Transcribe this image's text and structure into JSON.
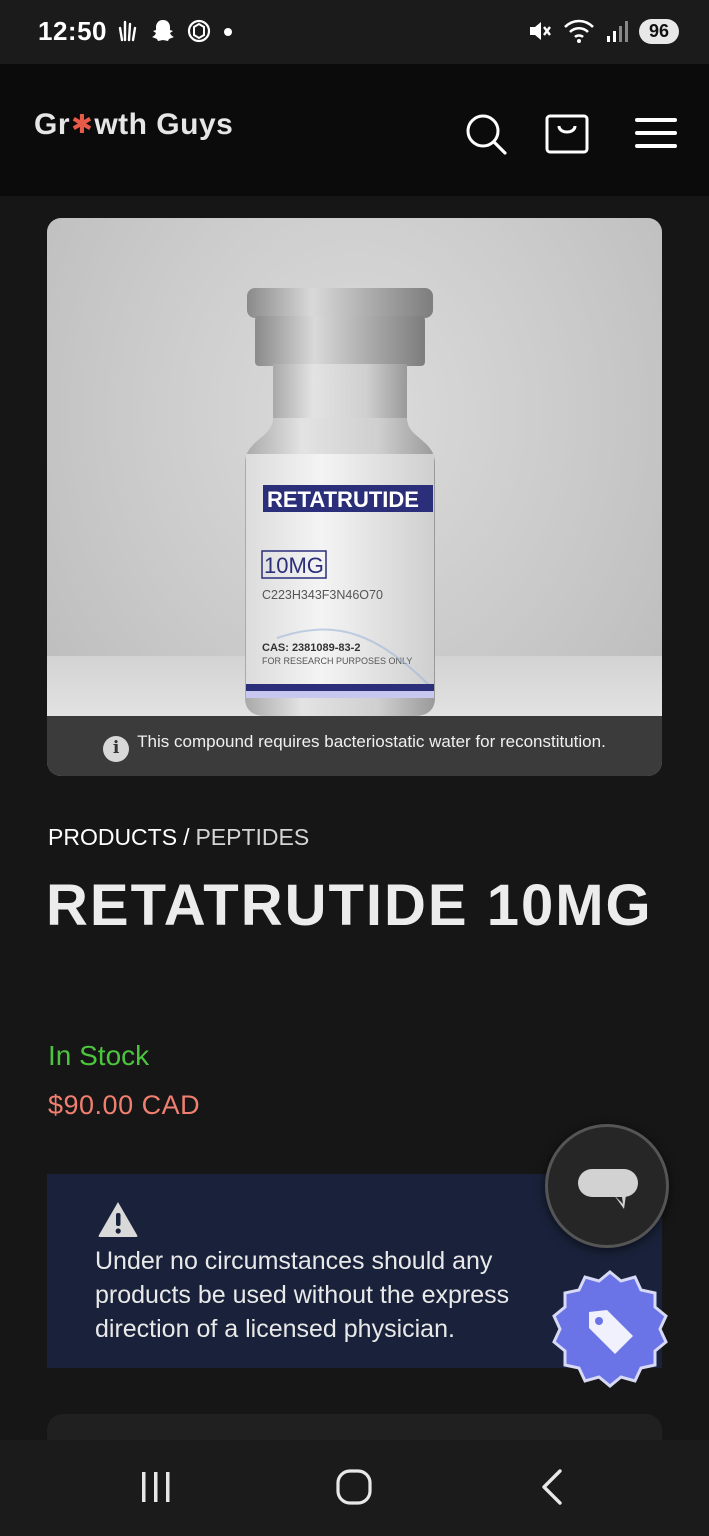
{
  "status_bar": {
    "time": "12:50",
    "battery": "96"
  },
  "header": {
    "logo_before": "Gr",
    "logo_star": "✱",
    "logo_after": "wth Guys"
  },
  "product_image": {
    "vial_name": "RETATRUTIDE",
    "vial_dose": "10MG",
    "vial_formula": "C223H343F3N46O70",
    "vial_cas": "CAS: 2381089-83-2",
    "vial_disclaimer": "FOR RESEARCH PURPOSES ONLY",
    "notice": "This compound requires bacteriostatic water for reconstitution."
  },
  "breadcrumb": {
    "level1": "PRODUCTS",
    "separator": "/",
    "level2": "PEPTIDES"
  },
  "product": {
    "title": "RETATRUTIDE 10MG",
    "stock_status": "In Stock",
    "price": "$90.00 CAD"
  },
  "warning": {
    "text": "Under no circumstances should any products be used without the express direction of a licensed physician."
  },
  "colors": {
    "in_stock": "#4cc43e",
    "price": "#f07f70",
    "warning_bg": "#19223a",
    "tag_fab": "#6b74e6",
    "vial_label_blue": "#2b2f7a"
  }
}
